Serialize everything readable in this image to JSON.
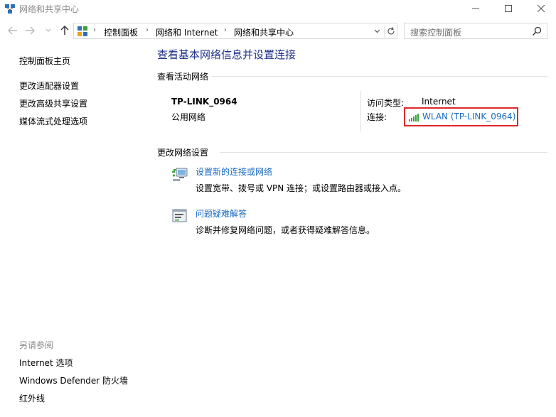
{
  "window": {
    "title": "网络和共享中心"
  },
  "nav": {
    "breadcrumbs": [
      "控制面板",
      "网络和 Internet",
      "网络和共享中心"
    ],
    "search_placeholder": "搜索控制面板"
  },
  "sidebar": {
    "items": [
      {
        "label": "控制面板主页"
      },
      {
        "label": "更改适配器设置"
      },
      {
        "label": "更改高级共享设置"
      },
      {
        "label": "媒体流式处理选项"
      }
    ],
    "see_also": {
      "heading": "另请参阅",
      "items": [
        {
          "label": "Internet 选项"
        },
        {
          "label": "Windows Defender 防火墙"
        },
        {
          "label": "红外线"
        }
      ]
    }
  },
  "main": {
    "title": "查看基本网络信息并设置连接",
    "active_networks": {
      "heading": "查看活动网络",
      "network_name": "TP-LINK_0964",
      "network_type": "公用网络",
      "access_type_label": "访问类型:",
      "access_type_value": "Internet",
      "connections_label": "连接:",
      "connection_link": "WLAN (TP-LINK_0964)"
    },
    "change_settings": {
      "heading": "更改网络设置",
      "tasks": [
        {
          "label": "设置新的连接或网络",
          "description": "设置宽带、拨号或 VPN 连接；或设置路由器或接入点。",
          "icon": "network-setup-icon"
        },
        {
          "label": "问题疑难解答",
          "description": "诊断并修复网络问题，或者获得疑难解答信息。",
          "icon": "troubleshoot-icon"
        }
      ]
    }
  },
  "colors": {
    "title_blue": "#1e3287",
    "link_blue": "#1a6ac2",
    "highlight_red": "#e0282c",
    "signal_green": "#3aa23a"
  }
}
